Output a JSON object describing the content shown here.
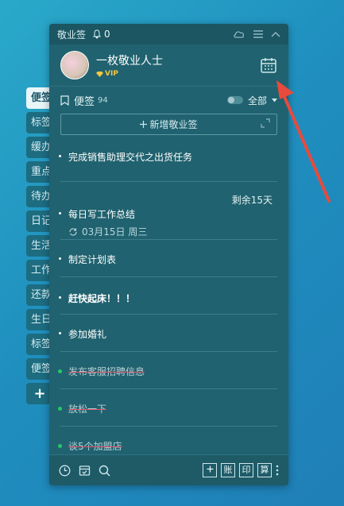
{
  "side_tabs": [
    "便签",
    "标签",
    "缓办",
    "重点",
    "待办",
    "日记",
    "生活",
    "工作",
    "还款",
    "生日",
    "标签",
    "便签"
  ],
  "side_add": "+",
  "titlebar": {
    "app": "敬业签",
    "bell_count": "0"
  },
  "user": {
    "name": "一枚敬业人士",
    "vip": "VIP"
  },
  "notes": {
    "title": "便签",
    "count": "94",
    "filter": "全部"
  },
  "add_note": "新增敬业签",
  "items": [
    {
      "text": "完成销售助理交代之出货任务"
    },
    {
      "text": "每日写工作总结",
      "remain": "剩余15天",
      "date": "03月15日 周三"
    },
    {
      "text": "制定计划表"
    },
    {
      "text": "赶快起床！！！"
    },
    {
      "text": "参加婚礼"
    },
    {
      "text": "发布客服招聘信息"
    },
    {
      "text": "放松一下"
    },
    {
      "text": "谈5个加盟店"
    }
  ],
  "bottom": {
    "b1": "账",
    "b2": "印",
    "b3": "算"
  },
  "colors": {
    "accent": "#20626f",
    "arrow": "#e84a3c",
    "done_dot": "#27c86a"
  }
}
